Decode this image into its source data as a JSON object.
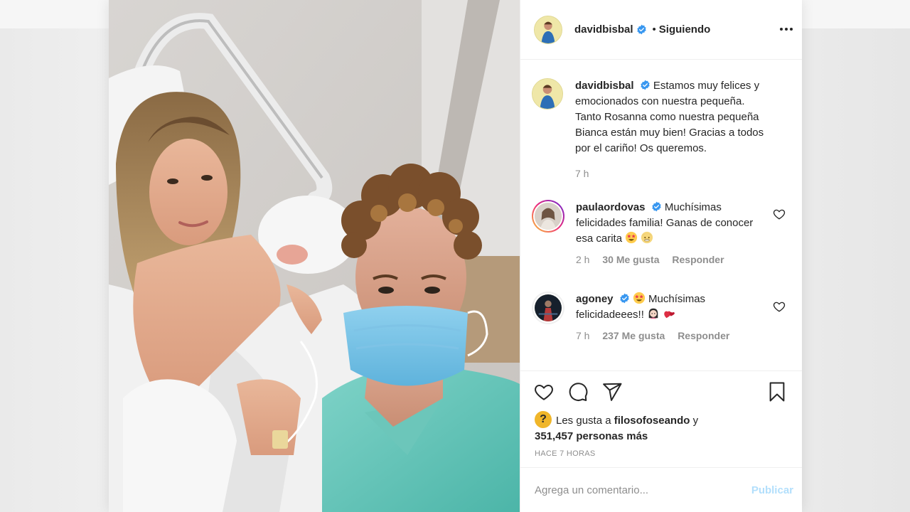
{
  "post": {
    "username": "davidbisbal",
    "follow_status": "Siguiendo",
    "separator": "•",
    "caption": "Estamos muy felices y emocionados con nuestra pequeña. Tanto Rosanna como nuestra pequeña Bianca están muy bien! Gracias a todos por el cariño! Os queremos.",
    "caption_time": "7 h"
  },
  "comments": [
    {
      "username": "paulaordovas",
      "text": "Muchísimas felicidades familia! Ganas de conocer esa carita",
      "time": "2 h",
      "likes": "30 Me gusta",
      "reply_label": "Responder",
      "emojis": [
        "star-struck-emoji",
        "cold-face-emoji"
      ]
    },
    {
      "username": "agoney",
      "text": "Muchísimas felicidadeees!!",
      "time": "7 h",
      "likes": "237 Me gusta",
      "reply_label": "Responder",
      "emojis": [
        "star-struck-emoji",
        "woman-emoji",
        "heart-exclamation-emoji"
      ]
    }
  ],
  "actions": {
    "likes_prefix": "Les gusta a",
    "liked_by": "filosofoseando",
    "likes_conj": "y",
    "likes_count": "351,457 personas más",
    "time_ago": "HACE 7 HORAS",
    "icons": [
      "heart-icon",
      "comment-icon",
      "share-icon",
      "bookmark-icon"
    ]
  },
  "composer": {
    "placeholder": "Agrega un comentario...",
    "publish_label": "Publicar"
  },
  "colors": {
    "verified": "#3897f0",
    "publish_disabled": "#b2dffc",
    "muted": "#8e8e8e",
    "text": "#262626"
  }
}
